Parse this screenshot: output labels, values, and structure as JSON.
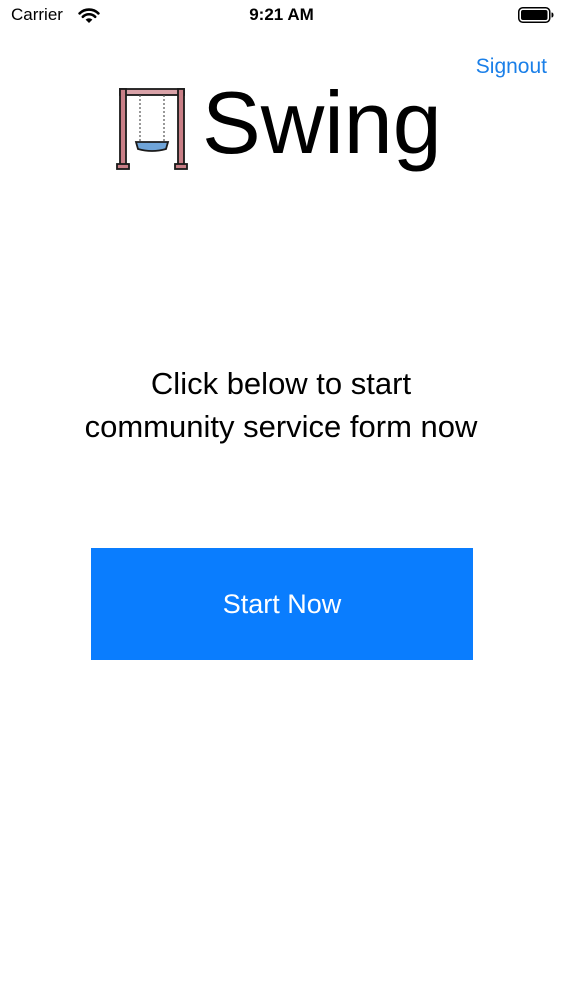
{
  "status_bar": {
    "carrier": "Carrier",
    "time": "9:21 AM"
  },
  "header": {
    "signout_label": "Signout",
    "brand_name": "Swing",
    "logo_icon": "swing-icon"
  },
  "main": {
    "message": "Click below to start community service form now",
    "start_button_label": "Start Now"
  },
  "colors": {
    "accent": "#0a7dfe",
    "link": "#1a7fe8",
    "swing_frame": "#c97f87",
    "swing_seat": "#6fa4d8"
  }
}
